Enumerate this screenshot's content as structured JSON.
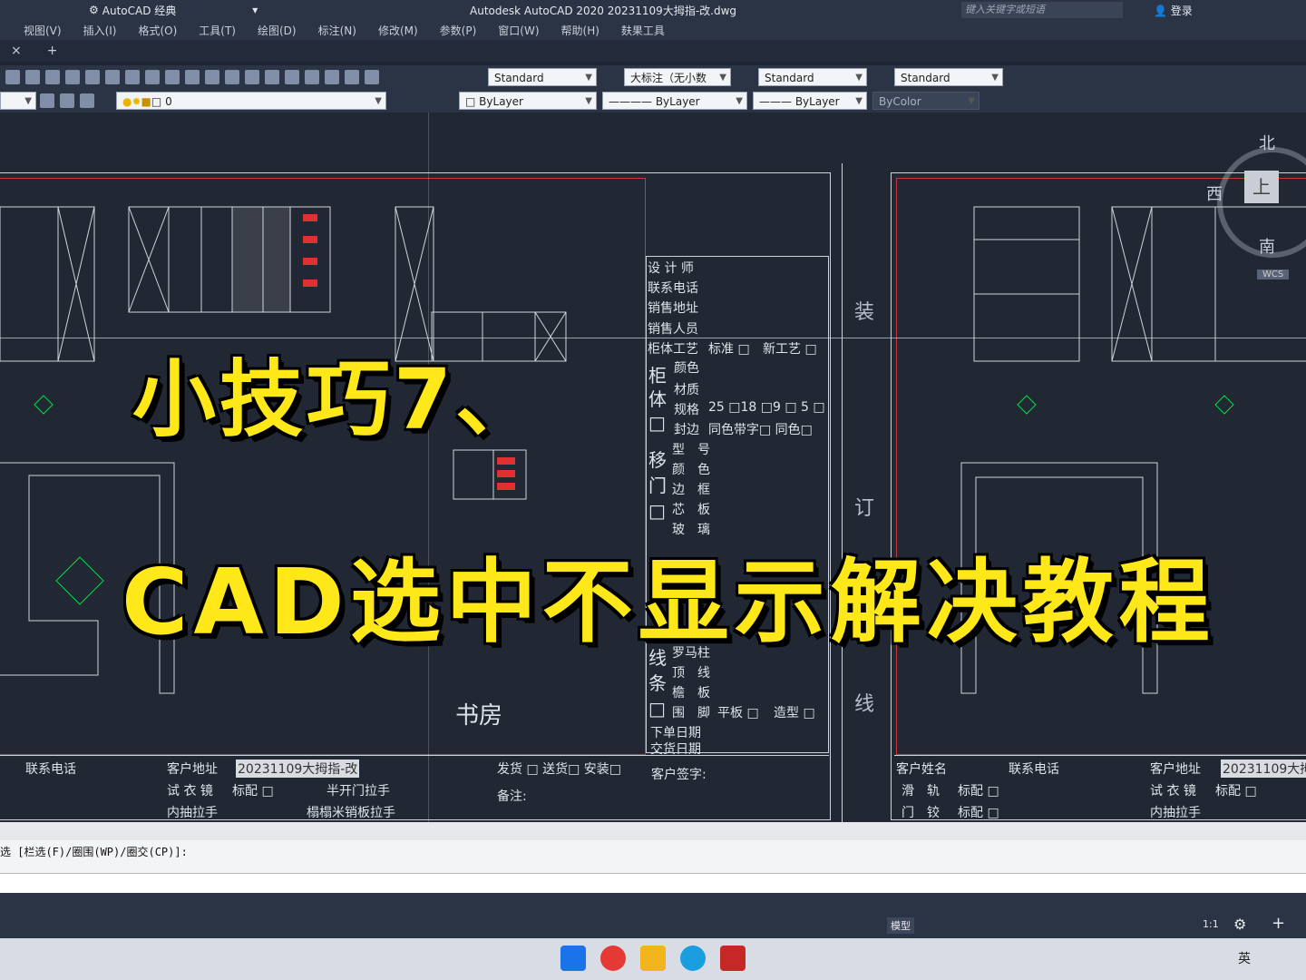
{
  "titlebar": {
    "workspace": "AutoCAD 经典",
    "title": "Autodesk AutoCAD 2020    20231109大拇指-改.dwg",
    "search_placeholder": "键入关键字或短语",
    "login": "登录"
  },
  "menubar": {
    "items": [
      "视图(V)",
      "插入(I)",
      "格式(O)",
      "工具(T)",
      "绘图(D)",
      "标注(N)",
      "修改(M)",
      "参数(P)",
      "窗口(W)",
      "帮助(H)",
      "麸果工具"
    ]
  },
  "tabs": {
    "close": "×",
    "add": "+"
  },
  "toolbar1": {
    "text_style": "Standard",
    "dim_style": "大标注（无小数",
    "table_style": "Standard",
    "multileader_style": "Standard"
  },
  "toolbar2": {
    "layer": "0",
    "color": "ByLayer",
    "linetype": "ByLayer",
    "lineweight": "ByLayer",
    "plotstyle": "ByColor"
  },
  "drawing": {
    "form_rows": [
      "设 计 师",
      "联系电话",
      "销售地址",
      "销售人员"
    ],
    "cabinet_process": "柜体工艺",
    "standard_opt": "标准 □",
    "new_process_opt": "新工艺 □",
    "cabinet_group": "柜体□",
    "color_label": "颜色",
    "material_label": "材质",
    "spec_label": "规格",
    "spec_options": "25 □18 □9 □ 5 □",
    "edge_label": "封边",
    "edge_options": "同色带字□ 同色□",
    "sliding_door_group": "移门□",
    "sliding_rows": [
      "型　号",
      "颜　色",
      "边　框",
      "芯　板",
      "玻　璃"
    ],
    "trim_group": "线条□",
    "trim_rows": [
      "罗马柱",
      "顶　线",
      "檐　板",
      "围　脚"
    ],
    "flat_opt": "平板 □",
    "shaped_opt": "造型 □",
    "order_date": "下单日期",
    "delivery_date": "交货日期",
    "customer_sign": "客户签字:",
    "binding_chars": [
      "装",
      "订",
      "线"
    ],
    "room_label": "书房",
    "bottom_left": {
      "contact": "联系电话",
      "address": "客户地址",
      "project": "20231109大拇指-改",
      "ship": "发货 □ 送货□ 安装□",
      "mirror": "试 衣 镜",
      "std_opt": "标配 □",
      "half_handle": "半开门拉手",
      "handle": "内抽拉手",
      "handle_spec": "榻榻米销板拉手",
      "note": "备注:"
    },
    "bottom_right": {
      "name": "客户姓名",
      "contact": "联系电话",
      "address": "客户地址",
      "project": "20231109大拇",
      "rail": "滑　轨",
      "rail_opt": "标配 □",
      "mirror": "试 衣 镜",
      "mirror_opt": "标配 □",
      "hinge": "门　铰",
      "hinge_opt": "标配 □",
      "handle": "内抽拉手"
    }
  },
  "overlay": {
    "line1": "小技巧7、",
    "line2": "CAD选中不显示解决教程"
  },
  "viewcube": {
    "north": "北",
    "west": "西",
    "top": "上",
    "south": "南",
    "wcs": "WCS"
  },
  "command_line": "选 [栏选(F)/圈围(WP)/圈交(CP)]:",
  "statusbar": {
    "model": "模型",
    "scale": "1:1"
  },
  "taskbar": {
    "ime": "英"
  }
}
